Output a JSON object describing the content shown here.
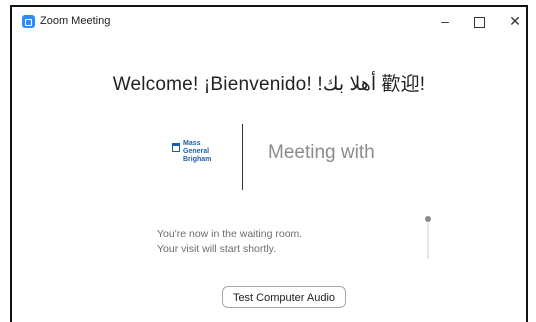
{
  "window": {
    "title": "Zoom Meeting",
    "minimize_glyph": "–",
    "maximize_glyph": "",
    "close_glyph": "✕"
  },
  "welcome_text": "Welcome!  ¡Bienvenido!  !أهلا بك  歡迎!",
  "logo": {
    "line1": "Mass",
    "line2": "General",
    "line3": "Brigham"
  },
  "meeting_with": "Meeting with",
  "waiting": {
    "line1": "You're now in the waiting room.",
    "line2": "Your visit will start shortly."
  },
  "buttons": {
    "test_audio": "Test Computer Audio"
  },
  "colors": {
    "accent": "#2d8cff",
    "logo_blue": "#1f5fa8"
  }
}
